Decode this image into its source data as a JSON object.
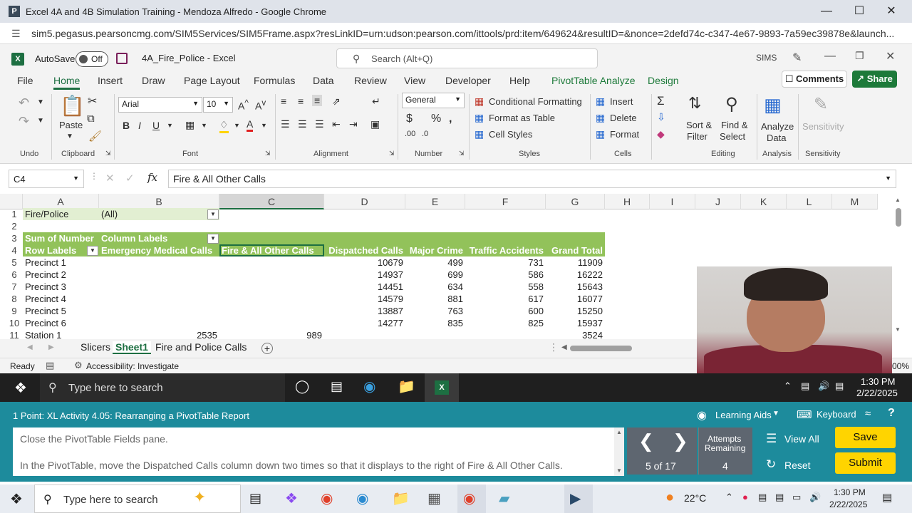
{
  "browser": {
    "title": "Excel 4A and 4B Simulation Training - Mendoza Alfredo - Google Chrome",
    "favicon": "P",
    "url": "sim5.pegasus.pearsoncmg.com/SIM5Services/SIM5Frame.aspx?resLinkID=urn:udson:pearson.com/ittools/prd:item/649624&resultID=&nonce=2defd74c-c347-4e67-9893-7a59ec39878e&launch..."
  },
  "excel": {
    "logo": "X",
    "autosave_label": "AutoSave",
    "autosave_state": "Off",
    "doc_title": "4A_Fire_Police - Excel",
    "search_placeholder": "Search (Alt+Q)",
    "user": "SIMS",
    "tabs": [
      "File",
      "Home",
      "Insert",
      "Draw",
      "Page Layout",
      "Formulas",
      "Data",
      "Review",
      "View",
      "Developer",
      "Help",
      "PivotTable Analyze",
      "Design"
    ],
    "comments_label": "Comments",
    "share_label": "Share"
  },
  "ribbon": {
    "undo_group": "Undo",
    "clipboard_group": "Clipboard",
    "paste_label": "Paste",
    "font_group": "Font",
    "font_name": "Arial",
    "font_size": "10",
    "alignment_group": "Alignment",
    "number_group": "Number",
    "number_format": "General",
    "styles_group": "Styles",
    "conditional_formatting": "Conditional Formatting",
    "format_as_table": "Format as Table",
    "cell_styles": "Cell Styles",
    "cells_group": "Cells",
    "insert": "Insert",
    "delete": "Delete",
    "format": "Format",
    "editing_group": "Editing",
    "sort_filter_1": "Sort &",
    "sort_filter_2": "Filter",
    "find_select_1": "Find &",
    "find_select_2": "Select",
    "analysis_group": "Analysis",
    "analyze_data_1": "Analyze",
    "analyze_data_2": "Data",
    "sensitivity_group": "Sensitivity",
    "sensitivity_label": "Sensitivity"
  },
  "formula_bar": {
    "name_box": "C4",
    "formula": "Fire & All Other Calls"
  },
  "sheet": {
    "columns": [
      "A",
      "B",
      "C",
      "D",
      "E",
      "F",
      "G",
      "H",
      "I",
      "J",
      "K",
      "L",
      "M"
    ],
    "row_numbers": [
      "1",
      "2",
      "3",
      "4",
      "5",
      "6",
      "7",
      "8",
      "9",
      "10",
      "11"
    ],
    "a1": "Fire/Police",
    "b1": "(All)",
    "a3": "Sum of Number",
    "b3": "Column Labels",
    "headers": [
      "Row Labels",
      "Emergency Medical Calls",
      "Fire & All Other Calls",
      "Dispatched Calls",
      "Major Crime",
      "Traffic Accidents",
      "Grand Total"
    ],
    "rows": [
      {
        "label": "Precinct 1",
        "b": "",
        "c": "",
        "d": "10679",
        "e": "499",
        "f": "731",
        "g": "11909"
      },
      {
        "label": "Precinct 2",
        "b": "",
        "c": "",
        "d": "14937",
        "e": "699",
        "f": "586",
        "g": "16222"
      },
      {
        "label": "Precinct 3",
        "b": "",
        "c": "",
        "d": "14451",
        "e": "634",
        "f": "558",
        "g": "15643"
      },
      {
        "label": "Precinct 4",
        "b": "",
        "c": "",
        "d": "14579",
        "e": "881",
        "f": "617",
        "g": "16077"
      },
      {
        "label": "Precinct 5",
        "b": "",
        "c": "",
        "d": "13887",
        "e": "763",
        "f": "600",
        "g": "15250"
      },
      {
        "label": "Precinct 6",
        "b": "",
        "c": "",
        "d": "14277",
        "e": "835",
        "f": "825",
        "g": "15937"
      },
      {
        "label": "Station 1",
        "b": "2535",
        "c": "989",
        "d": "",
        "e": "",
        "f": "",
        "g": "3524"
      }
    ],
    "sheet_tabs": [
      "Slicers",
      "Sheet1",
      "Fire and Police Calls"
    ],
    "active_sheet": "Sheet1"
  },
  "status_bar": {
    "ready": "Ready",
    "accessibility": "Accessibility: Investigate",
    "zoom": "00%"
  },
  "taskbar_top": {
    "search_placeholder": "Type here to search",
    "time": "1:30 PM",
    "date": "2/22/2025"
  },
  "instructions": {
    "title": "1 Point: XL Activity 4.05: Rearranging a PivotTable Report",
    "learning_aids": "Learning Aids",
    "keyboard": "Keyboard",
    "step1": "Close the PivotTable Fields pane.",
    "step2": "In the PivotTable, move the Dispatched Calls column down two times so that it displays to the right of Fire & All Other Calls.",
    "progress": "5 of 17",
    "attempts_label_1": "Attempts",
    "attempts_label_2": "Remaining",
    "attempts_value": "4",
    "view_all": "View All",
    "reset": "Reset",
    "save": "Save",
    "submit": "Submit"
  },
  "taskbar_bottom": {
    "search_placeholder": "Type here to search",
    "weather": "22°C",
    "time": "1:30 PM",
    "date": "2/22/2025"
  }
}
